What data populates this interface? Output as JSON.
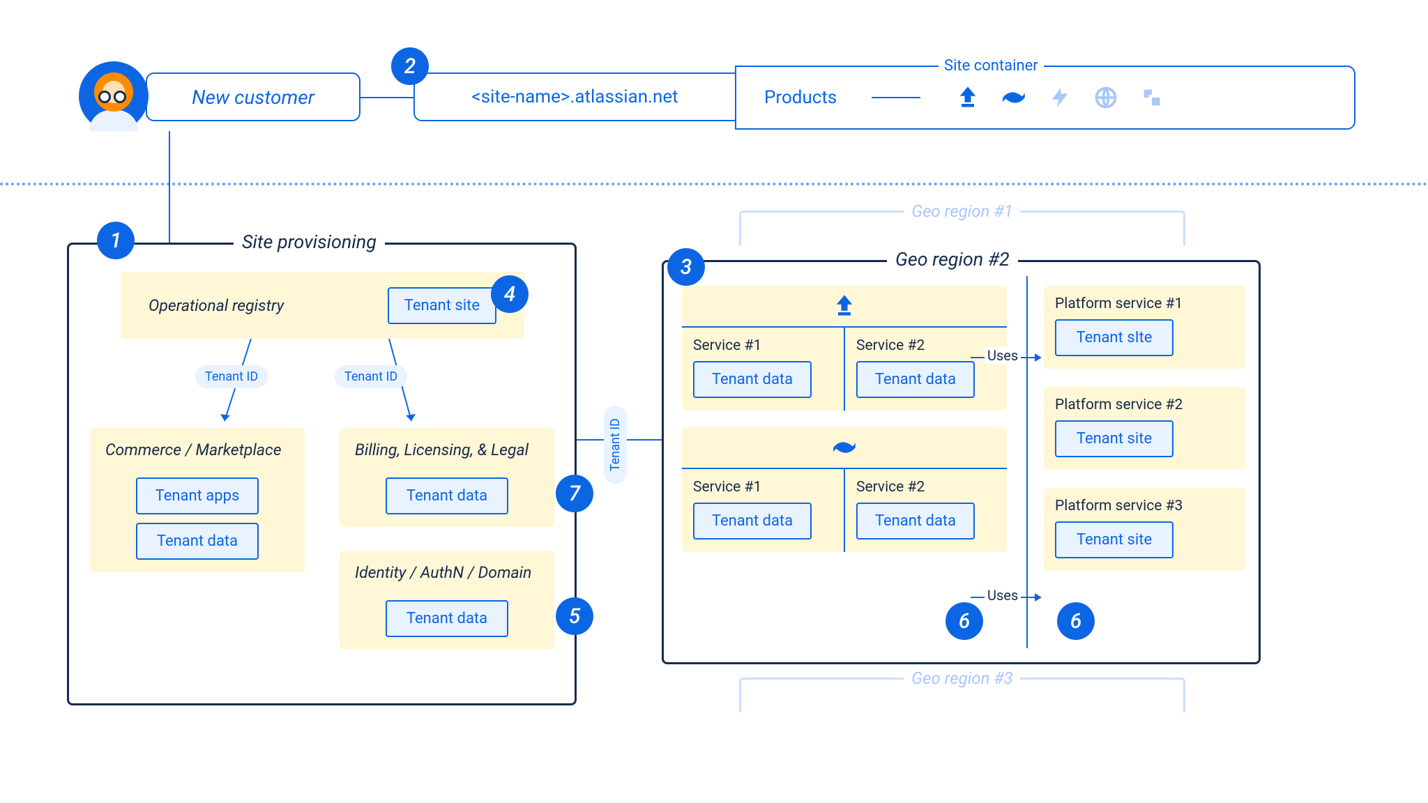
{
  "top": {
    "new_customer": "New customer",
    "site_url": "<site-name>.atlassian.net",
    "site_container_label": "Site container",
    "products_label": "Products"
  },
  "provisioning": {
    "title": "Site provisioning",
    "op_registry_title": "Operational registry",
    "tenant_site": "Tenant site",
    "tenant_id": "Tenant ID",
    "commerce_title": "Commerce / Marketplace",
    "tenant_apps": "Tenant apps",
    "tenant_data": "Tenant data",
    "billing_title": "Billing, Licensing, & Legal",
    "identity_title": "Identity / AuthN / Domain"
  },
  "geo": {
    "region1": "Geo region #1",
    "region2": "Geo region #2",
    "region3": "Geo region #3",
    "service1": "Service #1",
    "service2": "Service #2",
    "tenant_data": "Tenant data",
    "tenant_site": "Tenant site",
    "tenant_site_alt": "Tenant sIte",
    "platform1": "Platform service #1",
    "platform2": "Platform service #2",
    "platform3": "Platform service #3",
    "uses": "Uses"
  },
  "badges": {
    "b1": "1",
    "b2": "2",
    "b3": "3",
    "b4": "4",
    "b5": "5",
    "b6": "6",
    "b7": "7"
  }
}
